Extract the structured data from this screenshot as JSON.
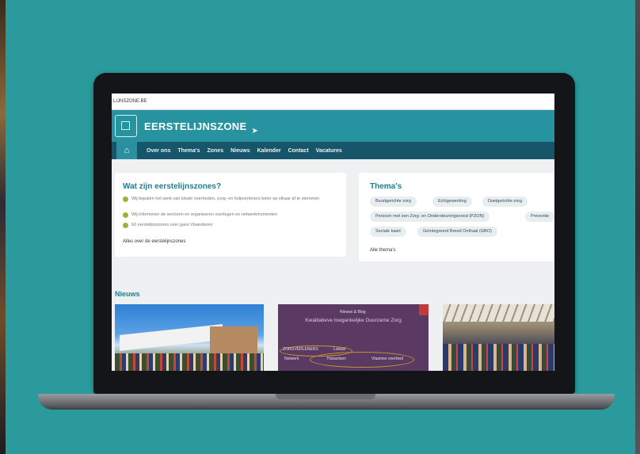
{
  "browser": {
    "address": "LIJNSZONE.BE"
  },
  "site": {
    "logo_text": "EERSTELIJNSZONE"
  },
  "nav": {
    "home_icon": "home-icon",
    "items": [
      "Over ons",
      "Thema's",
      "Zones",
      "Nieuws",
      "Kalender",
      "Contact",
      "Vacatures"
    ]
  },
  "intro": {
    "title": "Wat zijn eerstelijnszones?",
    "bullets": [
      "Wij bepalen het werk van lokale overheden, zorg- en hulpverleners beter op elkaar af te stemmen",
      "Wij informeren de sectoren en organiseren overlegen en netwerkmomenten",
      "60 eerstelijnszones over gans Vlaanderen"
    ],
    "link": "Alles over de eerstelijnszones"
  },
  "themas": {
    "title": "Thema's",
    "tags": [
      "Buurtgerichte zorg",
      "Echigewerking",
      "Doelgerichte zorg",
      "Persoon met een Zorg- en Ondersteuningsnood (PZON)",
      "Preventie",
      "Sociale kaart",
      "Geïntegreerd Breed Onthaal (GBO)"
    ],
    "link": "Alle thema's"
  },
  "news": {
    "title": "Nieuws",
    "item2": {
      "header": "Nieuws & Blog",
      "title": "Kwalitatieve toegankelijke Duurzame Zorg",
      "labels": [
        "ZORGVERLENERS",
        "Lokaal",
        "Netwerk",
        "Huisartsen",
        "Vlaamse overheid"
      ]
    }
  },
  "colors": {
    "background": "#2a9a9c",
    "header": "#2893a0",
    "nav": "#17566a",
    "accent": "#1d7f8d"
  }
}
